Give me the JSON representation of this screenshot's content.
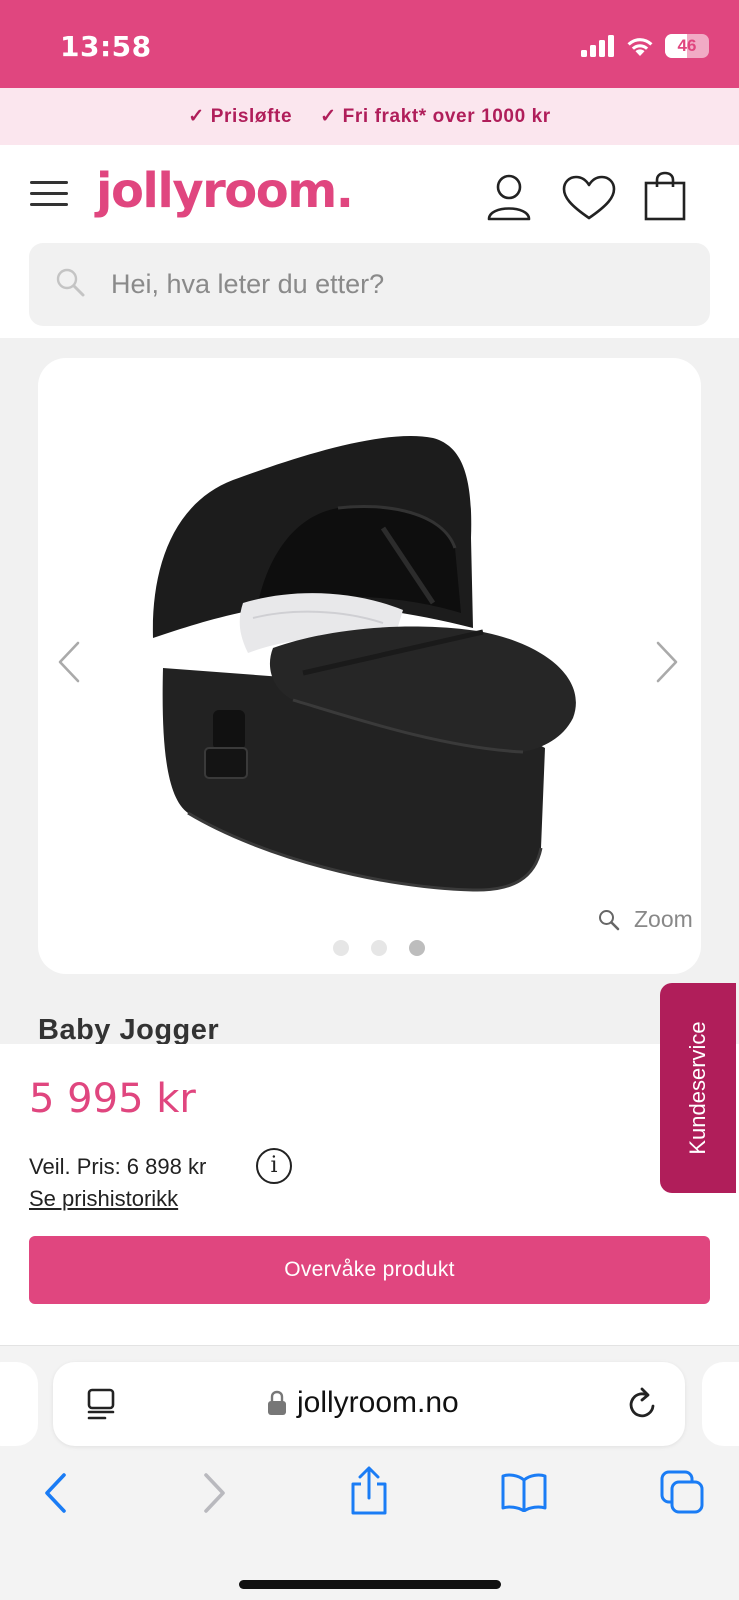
{
  "status_bar": {
    "time": "13:58",
    "battery": "46"
  },
  "promo": {
    "item1": "Prisløfte",
    "item2": "Fri frakt* over 1000 kr"
  },
  "header": {
    "logo": "jollyroom.",
    "search_placeholder": "Hei, hva leter du etter?"
  },
  "gallery": {
    "zoom_label": "Zoom",
    "slide_count": 3,
    "active_slide": 3
  },
  "product": {
    "brand": "Baby Jogger",
    "price": "5 995 kr",
    "recommended_price": "Veil. Pris: 6 898 kr",
    "price_history_link": "Se prishistorikk",
    "watch_button": "Overvåke produkt"
  },
  "customer_service": {
    "label": "Kundeservice"
  },
  "browser": {
    "url": "jollyroom.no"
  },
  "colors": {
    "brand_pink": "#e0467f",
    "dark_pink": "#b01e5a",
    "promo_bg": "#fbe6ee",
    "browser_blue": "#1a7cf5"
  }
}
